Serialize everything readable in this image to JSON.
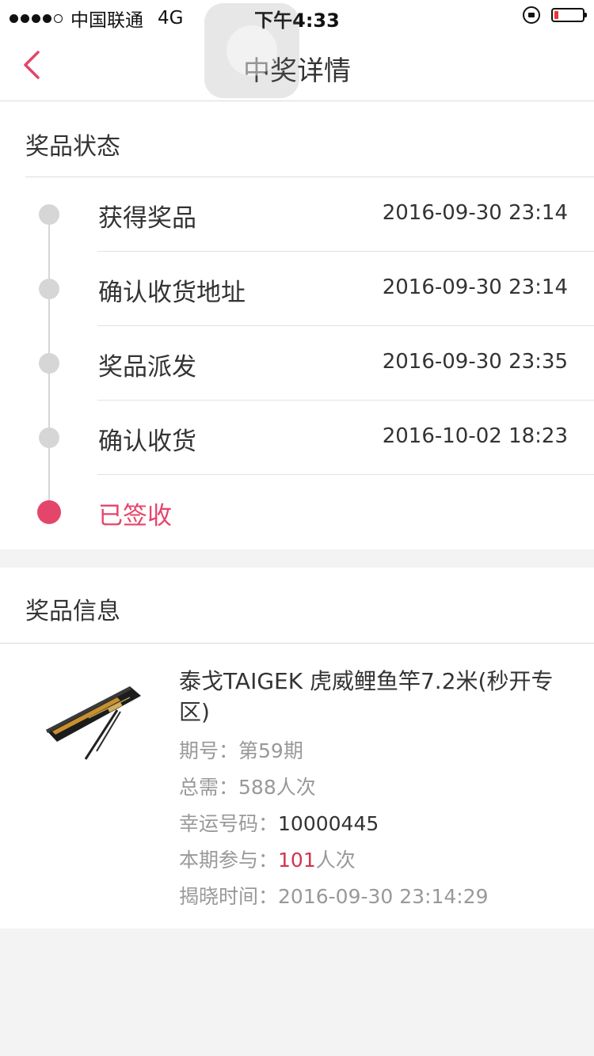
{
  "status_bar": {
    "carrier": "中国联通",
    "network": "4G",
    "time": "下午4:33",
    "battery_level": 0.15,
    "signal_bars": 4
  },
  "nav": {
    "title": "中奖详情"
  },
  "prize_status": {
    "title": "奖品状态",
    "steps": [
      {
        "label": "获得奖品",
        "time": "2016-09-30 23:14"
      },
      {
        "label": "确认收货地址",
        "time": "2016-09-30 23:14"
      },
      {
        "label": "奖品派发",
        "time": "2016-09-30 23:35"
      },
      {
        "label": "确认收货",
        "time": "2016-10-02 18:23"
      },
      {
        "label": "已签收",
        "time": ""
      }
    ]
  },
  "prize_info": {
    "title": "奖品信息",
    "product_title": "泰戈TAIGEK 虎威鲤鱼竿7.2米(秒开专区)",
    "rows": {
      "period_label": "期号：",
      "period_value": "第59期",
      "total_label": "总需：",
      "total_value": "588人次",
      "lucky_label": "幸运号码：",
      "lucky_value": "10000445",
      "join_label": "本期参与：",
      "join_count": "101",
      "join_unit": "人次",
      "reveal_label": "揭晓时间：",
      "reveal_value": "2016-09-30 23:14:29"
    }
  },
  "colors": {
    "accent": "#e4456a",
    "red_number": "#d2344c",
    "bullet_gray": "#d6d6d6",
    "background": "#f3f3f3"
  }
}
